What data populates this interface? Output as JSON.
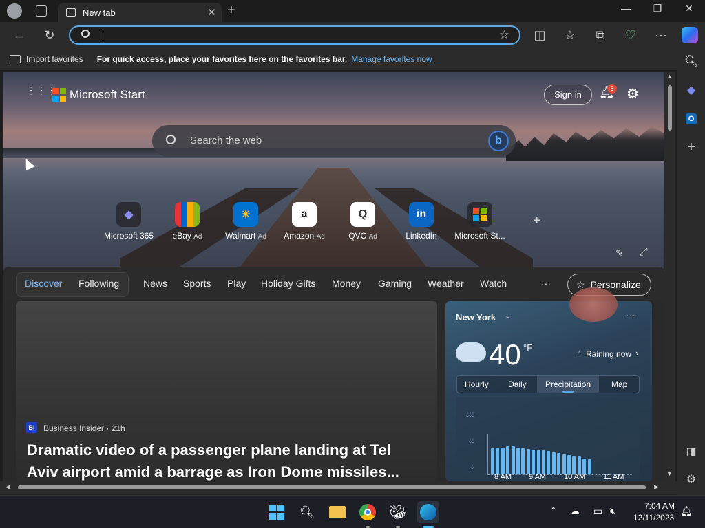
{
  "browser": {
    "tab_title": "New tab",
    "address_placeholder": "",
    "favorites_bar": {
      "import_label": "Import favorites",
      "message": "For quick access, place your favorites here on the favorites bar.",
      "manage_link": "Manage favorites now"
    }
  },
  "page": {
    "brand": "Microsoft Start",
    "sign_in": "Sign in",
    "notification_count": "5",
    "search_placeholder": "Search the web",
    "shortcuts": [
      {
        "label": "Microsoft 365",
        "ad": ""
      },
      {
        "label": "eBay",
        "ad": "Ad"
      },
      {
        "label": "Walmart",
        "ad": "Ad"
      },
      {
        "label": "Amazon",
        "ad": "Ad"
      },
      {
        "label": "QVC",
        "ad": "Ad"
      },
      {
        "label": "LinkedIn",
        "ad": ""
      },
      {
        "label": "Microsoft St...",
        "ad": ""
      }
    ],
    "nav_tabs": [
      "Discover",
      "Following",
      "News",
      "Sports",
      "Play",
      "Holiday Gifts",
      "Money",
      "Gaming",
      "Weather",
      "Watch"
    ],
    "more": "···",
    "personalize": "Personalize",
    "news": {
      "source_badge": "BI",
      "source": "Business Insider · 21h",
      "headline_line1": "Dramatic video of a passenger plane landing at Tel",
      "headline_line2": "Aviv airport amid a barrage as Iron Dome missiles..."
    },
    "weather": {
      "city": "New York",
      "temp": "40",
      "unit": "°F",
      "status": "Raining now",
      "tabs": [
        "Hourly",
        "Daily",
        "Precipitation",
        "Map"
      ],
      "active_tab": "Precipitation",
      "times": [
        "8 AM",
        "9 AM",
        "10 AM",
        "11 AM"
      ],
      "precip_bars": [
        0.65,
        0.68,
        0.68,
        0.7,
        0.7,
        0.68,
        0.66,
        0.64,
        0.62,
        0.6,
        0.6,
        0.58,
        0.56,
        0.54,
        0.5,
        0.48,
        0.45,
        0.45,
        0.4,
        0.38
      ]
    }
  },
  "taskbar": {
    "time": "7:04 AM",
    "date": "12/11/2023"
  },
  "colors": {
    "accent": "#5fa8e3",
    "link": "#6cb8f6"
  }
}
